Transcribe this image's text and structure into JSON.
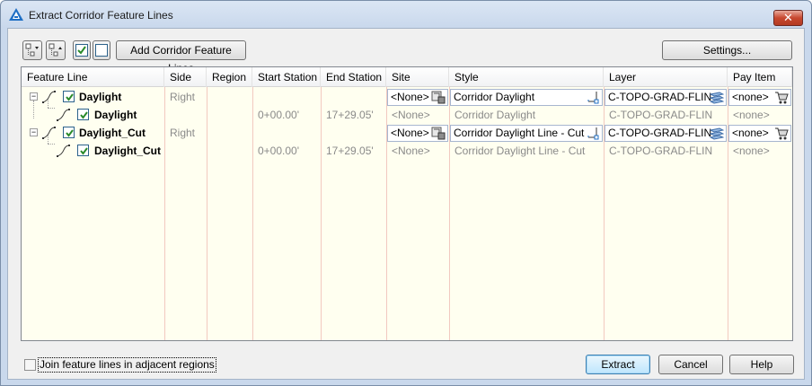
{
  "window": {
    "title": "Extract Corridor Feature Lines",
    "close_label": "✕"
  },
  "toolbar": {
    "add_label": "Add Corridor Feature Lines",
    "settings_label": "Settings..."
  },
  "columns": [
    "Feature Line",
    "Side",
    "Region",
    "Start Station",
    "End Station",
    "Site",
    "Style",
    "Layer",
    "Pay Item"
  ],
  "rows": [
    {
      "name": "Daylight",
      "side": "Right",
      "region": "",
      "start": "",
      "end": "",
      "site": "<None>",
      "style": "Corridor Daylight",
      "layer": "C-TOPO-GRAD-FLIN",
      "pay": "<none>",
      "level": 0,
      "editable": true
    },
    {
      "name": "Daylight",
      "side": "",
      "region": "",
      "start": "0+00.00'",
      "end": "17+29.05'",
      "site": "<None>",
      "style": "Corridor Daylight",
      "layer": "C-TOPO-GRAD-FLIN",
      "pay": "<none>",
      "level": 1,
      "editable": false
    },
    {
      "name": "Daylight_Cut",
      "side": "Right",
      "region": "",
      "start": "",
      "end": "",
      "site": "<None>",
      "style": "Corridor Daylight Line - Cut",
      "layer": "C-TOPO-GRAD-FLIN",
      "pay": "<none>",
      "level": 0,
      "editable": true
    },
    {
      "name": "Daylight_Cut",
      "side": "",
      "region": "",
      "start": "0+00.00'",
      "end": "17+29.05'",
      "site": "<None>",
      "style": "Corridor Daylight Line - Cut",
      "layer": "C-TOPO-GRAD-FLIN",
      "pay": "<none>",
      "level": 1,
      "editable": false
    }
  ],
  "footer": {
    "join_label": "Join feature lines in adjacent regions",
    "extract_label": "Extract",
    "cancel_label": "Cancel",
    "help_label": "Help"
  }
}
